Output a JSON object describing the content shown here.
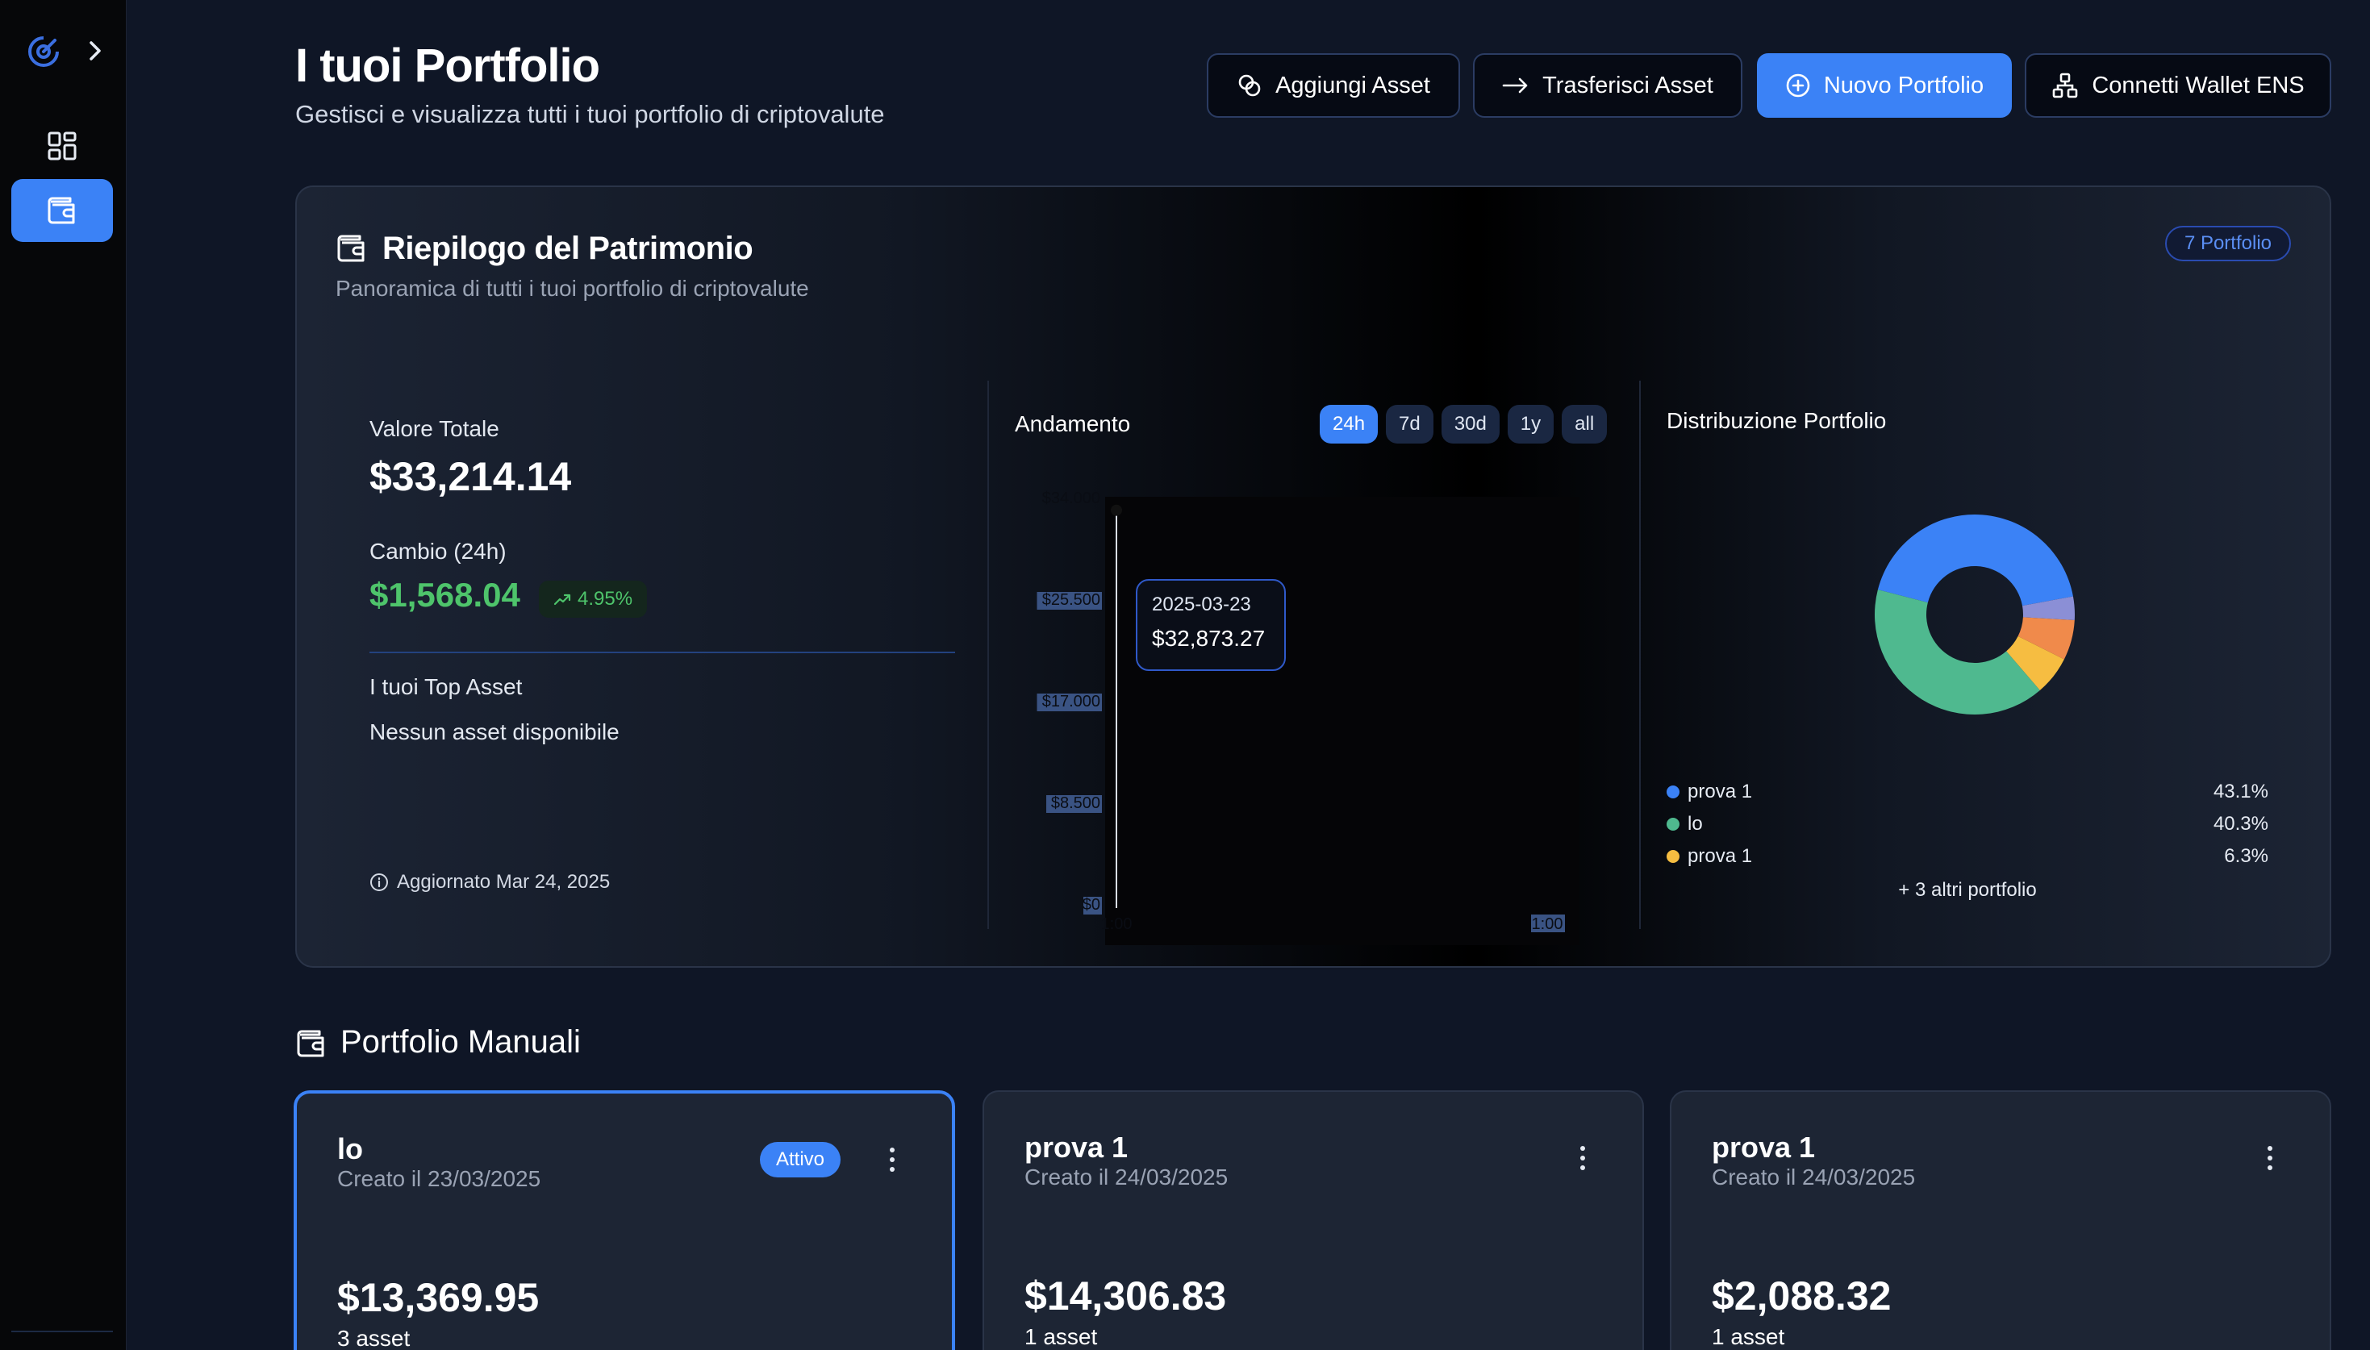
{
  "header": {
    "title": "I tuoi Portfolio",
    "subtitle": "Gestisci e visualizza tutti i tuoi portfolio di criptovalute",
    "buttons": {
      "add_asset": "Aggiungi Asset",
      "transfer_asset": "Trasferisci Asset",
      "new_portfolio": "Nuovo Portfolio",
      "connect_wallet": "Connetti Wallet ENS"
    }
  },
  "summary": {
    "title": "Riepilogo del Patrimonio",
    "subtitle": "Panoramica di tutti i tuoi portfolio di criptovalute",
    "portfolio_count": "7 Portfolio",
    "total_label": "Valore Totale",
    "total_value": "$33,214.14",
    "change_label": "Cambio (24h)",
    "change_value": "$1,568.04",
    "change_pct": "4.95%",
    "top_assets_label": "I tuoi Top Asset",
    "top_assets_empty": "Nessun asset disponibile",
    "updated": "Aggiornato Mar 24, 2025"
  },
  "trend": {
    "title": "Andamento",
    "ranges": [
      "24h",
      "7d",
      "30d",
      "1y",
      "all"
    ],
    "active_range": "24h",
    "tooltip_date": "2025-03-23",
    "tooltip_value": "$32,873.27"
  },
  "chart_data": {
    "type": "line",
    "title": "Andamento",
    "xlabel": "",
    "ylabel": "",
    "y_ticks": [
      "$34.000",
      "$25.500",
      "$17.000",
      "$8.500",
      "$0"
    ],
    "x_ticks": [
      "1:00",
      "1:00"
    ],
    "ylim": [
      0,
      34000
    ],
    "series": [
      {
        "values": [
          32873.27
        ]
      }
    ],
    "grid": false
  },
  "distribution": {
    "title": "Distribuzione Portfolio",
    "slices": [
      {
        "name": "prova 1",
        "pct": 43.1,
        "color": "#3b82f6"
      },
      {
        "name": "lo",
        "pct": 40.3,
        "color": "#4fb98f"
      },
      {
        "name": "prova 1",
        "pct": 6.3,
        "color": "#f6bd41"
      },
      {
        "pct": 6.5,
        "color": "#f08a4b"
      },
      {
        "pct": 3.8,
        "color": "#8b8fd6"
      }
    ],
    "legend": [
      {
        "name": "prova 1",
        "pct": "43.1%",
        "color": "#3b82f6"
      },
      {
        "name": "lo",
        "pct": "40.3%",
        "color": "#4fb98f"
      },
      {
        "name": "prova 1",
        "pct": "6.3%",
        "color": "#f6bd41"
      }
    ],
    "more": "+ 3 altri portfolio"
  },
  "manual": {
    "title": "Portfolio Manuali",
    "cards": [
      {
        "name": "lo",
        "created": "Creato il 23/03/2025",
        "value": "$13,369.95",
        "assets": "3 asset",
        "status": "Attivo"
      },
      {
        "name": "prova 1",
        "created": "Creato il 24/03/2025",
        "value": "$14,306.83",
        "assets": "1 asset"
      },
      {
        "name": "prova 1",
        "created": "Creato il 24/03/2025",
        "value": "$2,088.32",
        "assets": "1 asset"
      }
    ]
  }
}
